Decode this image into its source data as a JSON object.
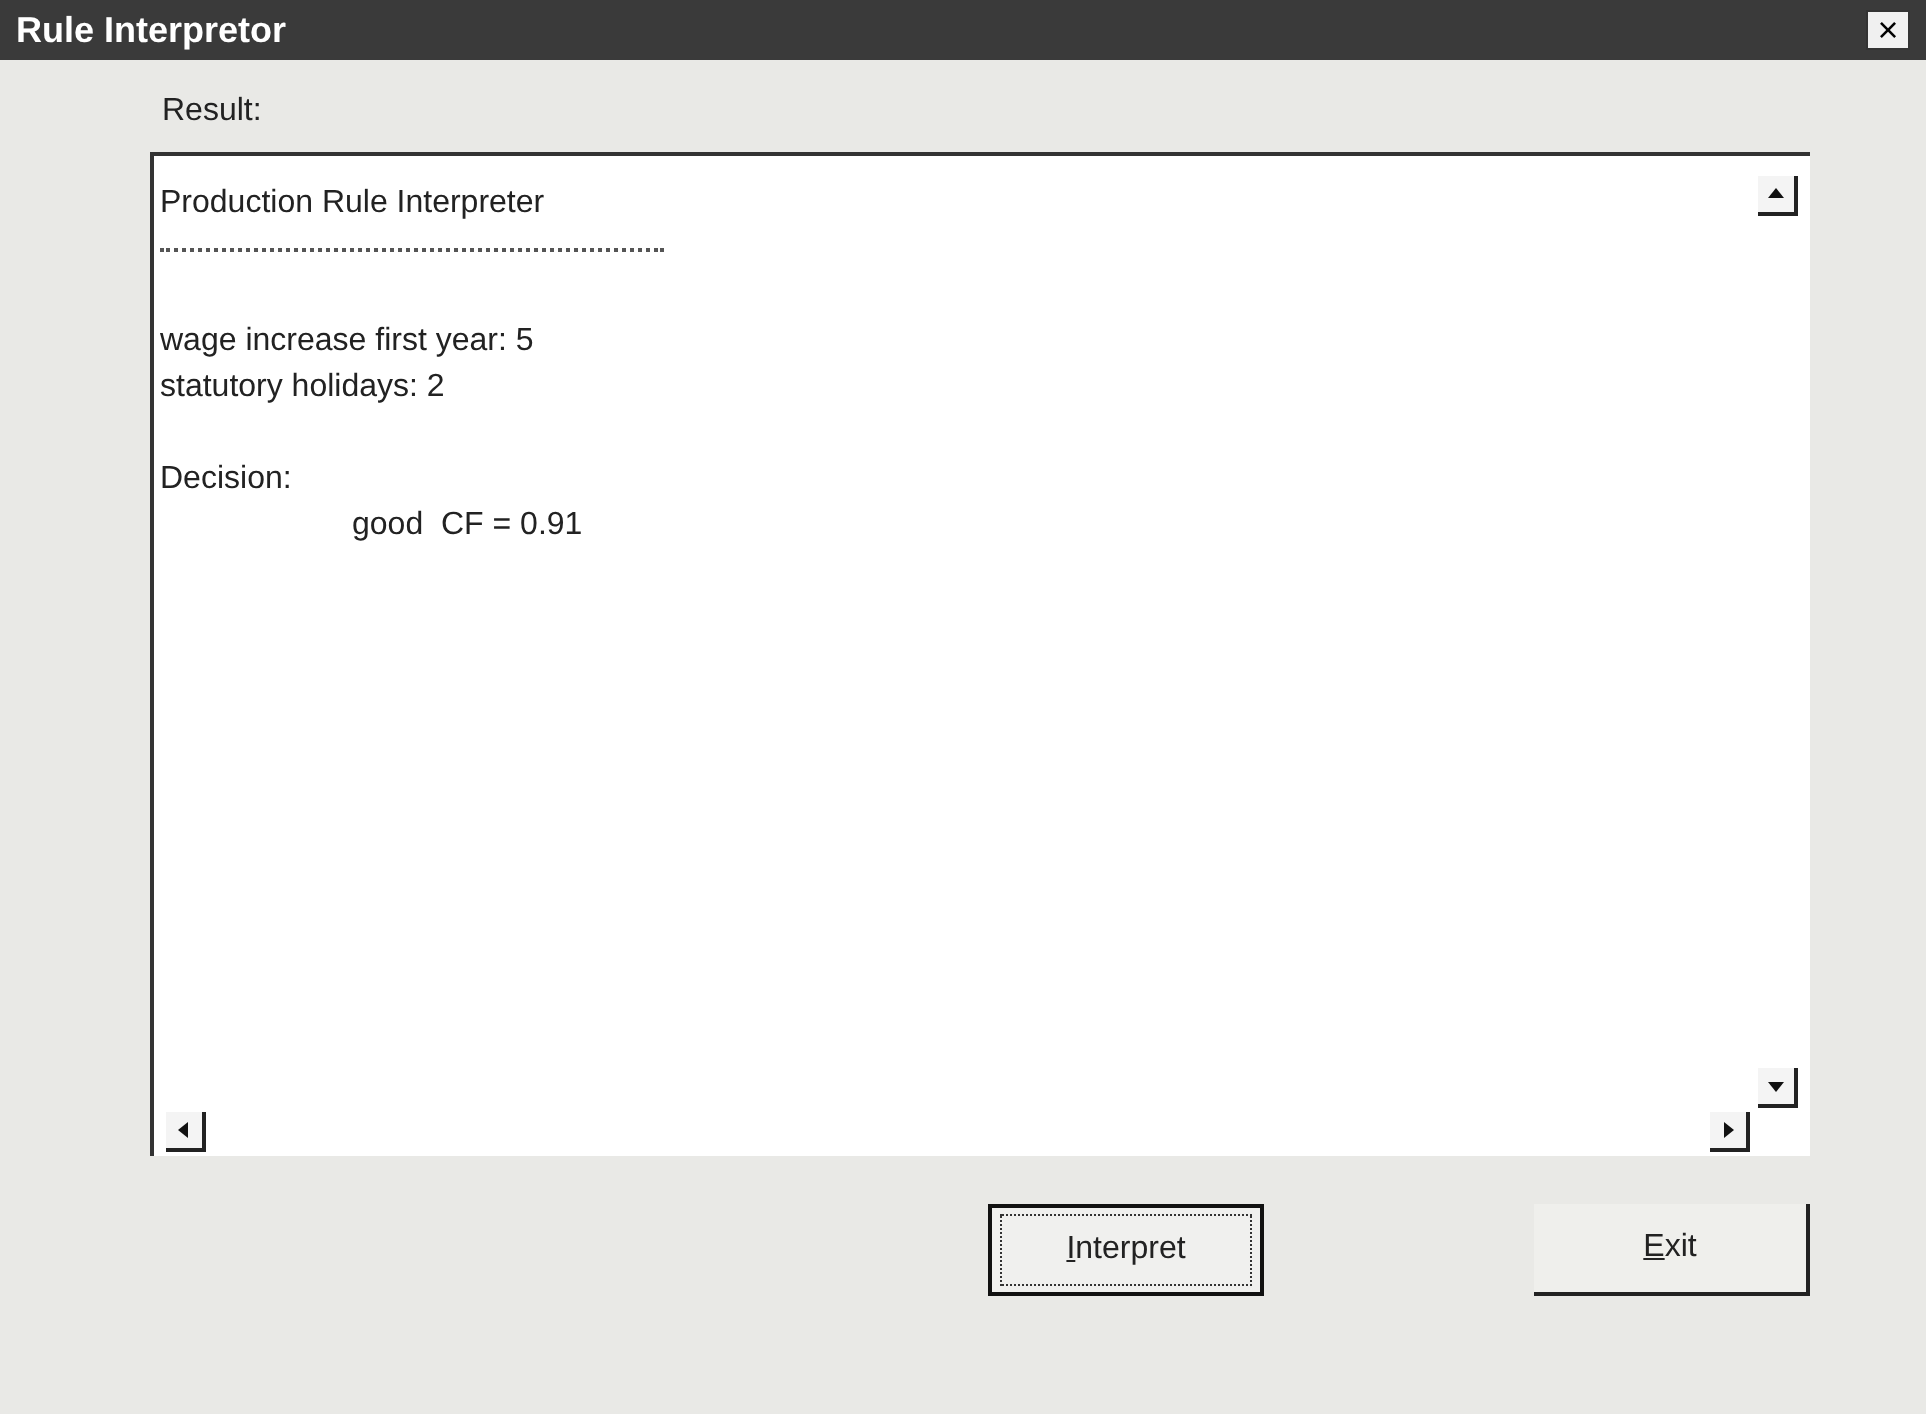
{
  "window": {
    "title": "Rule Interpretor",
    "close": "×"
  },
  "result": {
    "label": "Result:",
    "lines": [
      {
        "kind": "text",
        "text": "Production Rule Interpreter",
        "indent": false
      },
      {
        "kind": "separator"
      },
      {
        "kind": "blank"
      },
      {
        "kind": "text",
        "text": "wage increase first year: 5",
        "indent": false
      },
      {
        "kind": "text",
        "text": "statutory holidays: 2",
        "indent": false
      },
      {
        "kind": "blank"
      },
      {
        "kind": "text",
        "text": "Decision:",
        "indent": false
      },
      {
        "kind": "text",
        "text": "good  CF = 0.91",
        "indent": true
      }
    ]
  },
  "buttons": [
    {
      "label": "Interpret",
      "underline_first": true,
      "focused": true
    },
    {
      "label": "Exit",
      "underline_first": true,
      "focused": false
    }
  ]
}
